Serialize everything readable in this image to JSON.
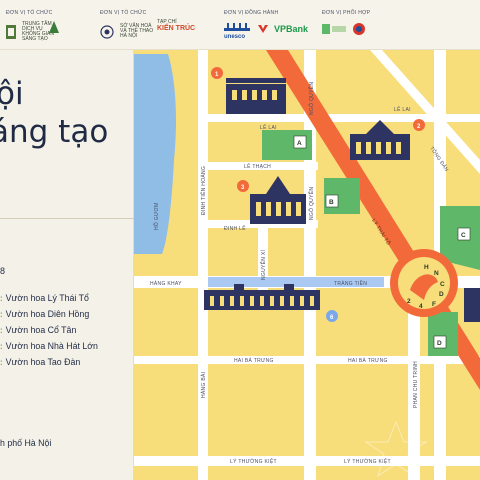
{
  "header": {
    "organizer_label": "ĐƠN VỊ TỔ CHỨC",
    "organizer_logo_text": "TRUNG TÂM DỊCH VỤ KHÔNG GIAN SÁNG TẠO",
    "organizer2_label": "ĐƠN VỊ TỔ CHỨC",
    "organizer2_logo_text": "SỞ VĂN HOÁ VÀ THỂ THAO HÀ NỘI",
    "magazine_label": "TẠP CHÍ",
    "magazine_name": "KIẾN TRÚC",
    "partner_label": "ĐƠN VỊ ĐỒNG HÀNH",
    "unesco": "unesco",
    "vpbank": "VPBank",
    "coop_label": "ĐƠN VỊ PHỐI HỢP"
  },
  "panel": {
    "title_line1": "ội",
    "title_line2": "áng tạo",
    "title_line3": "ı",
    "count": "8",
    "gardens": [
      "Vườn hoa Lý Thái Tổ",
      "Vườn hoa Diên Hồng",
      "Vườn hoa Cổ Tân",
      "Vườn hoa Nhà Hát Lớn",
      "Vườn hoa Tao Đàn"
    ],
    "organizer_footer": "h phố Hà Nội"
  },
  "map": {
    "streets": {
      "le_lai_1": "LÊ LAI",
      "le_lai_2": "LÊ LAI",
      "le_thach": "LÊ THẠCH",
      "dinh_tien_hoang": "ĐINH TIÊN HOÀNG",
      "ngo_quyen_1": "NGÔ QUYỀN",
      "ngo_quyen_2": "NGÔ QUYỀN",
      "ly_thai_to": "LÝ THÁI TỔ",
      "tong_dan": "TÔNG ĐẢN",
      "dinh_le": "ĐINH LỄ",
      "nguyen_xi": "NGUYỄN XÍ",
      "ho_guom": "HỒ GƯƠM",
      "hang_khay": "HÀNG KHAY",
      "trang_tien": "TRÀNG TIỀN",
      "hang_bai": "HÀNG BÀI",
      "hai_ba_trung_1": "HAI BÀ TRƯNG",
      "hai_ba_trung_2": "HAI BÀ TRƯNG",
      "phan_chu_trinh": "PHAN CHU TRINH",
      "ly_thuong_kiet_1": "LÝ THƯỜNG KIỆT",
      "ly_thuong_kiet_2": "LÝ THƯỜNG KIỆT"
    },
    "zones": {
      "a": "A",
      "b": "B",
      "c": "C",
      "d": "D"
    },
    "markers": {
      "m1": "1",
      "m2": "2",
      "m3": "3",
      "m6": "6"
    },
    "hub_letters": [
      "H",
      "N",
      "C",
      "D",
      "F",
      "4",
      "2"
    ],
    "colors": {
      "block": "#f8dd7b",
      "road": "#ffffff",
      "lake": "#8fbde6",
      "highlight_road": "#f26a3a",
      "green_zone": "#5fb86a",
      "trang_tien_band": "#a9c9f2",
      "building": "#2d3461"
    }
  }
}
